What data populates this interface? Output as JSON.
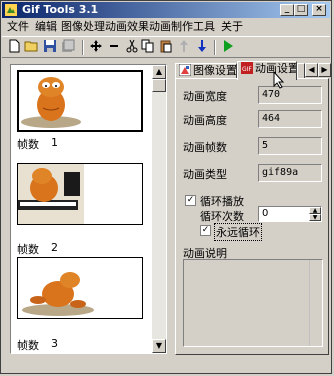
{
  "window": {
    "title": "Gif Tools 3.1"
  },
  "menu": [
    "文件",
    "编辑",
    "图像处理",
    "动画效果",
    "动画制作",
    "工具",
    "关于"
  ],
  "toolbar": {
    "icons": [
      "new-icon",
      "open-icon",
      "save-icon",
      "save-all-icon",
      "move-icon",
      "minus-icon",
      "cut-icon",
      "copy-icon",
      "paste-icon",
      "up-icon",
      "down-icon",
      "play-icon"
    ]
  },
  "frames": [
    {
      "label": "帧数",
      "number": "1"
    },
    {
      "label": "帧数",
      "number": "2"
    },
    {
      "label": "帧数",
      "number": "3"
    }
  ],
  "tabs": {
    "image_settings": "图像设置",
    "animation_settings": "动画设置"
  },
  "props": {
    "width_label": "动画宽度",
    "width_value": "470",
    "height_label": "动画高度",
    "height_value": "464",
    "frames_label": "动画帧数",
    "frames_value": "5",
    "type_label": "动画类型",
    "type_value": "gif89a"
  },
  "loop": {
    "label": "循环播放",
    "checked": true,
    "count_label": "循环次数",
    "count_value": "0",
    "forever_label": "永远循环",
    "forever_checked": true
  },
  "description": {
    "label": "动画说明",
    "text": ""
  },
  "colors": {
    "title_start": "#0a246a",
    "title_end": "#a6caf0",
    "face": "#d4d0c8",
    "cat_orange": "#d9741c"
  }
}
